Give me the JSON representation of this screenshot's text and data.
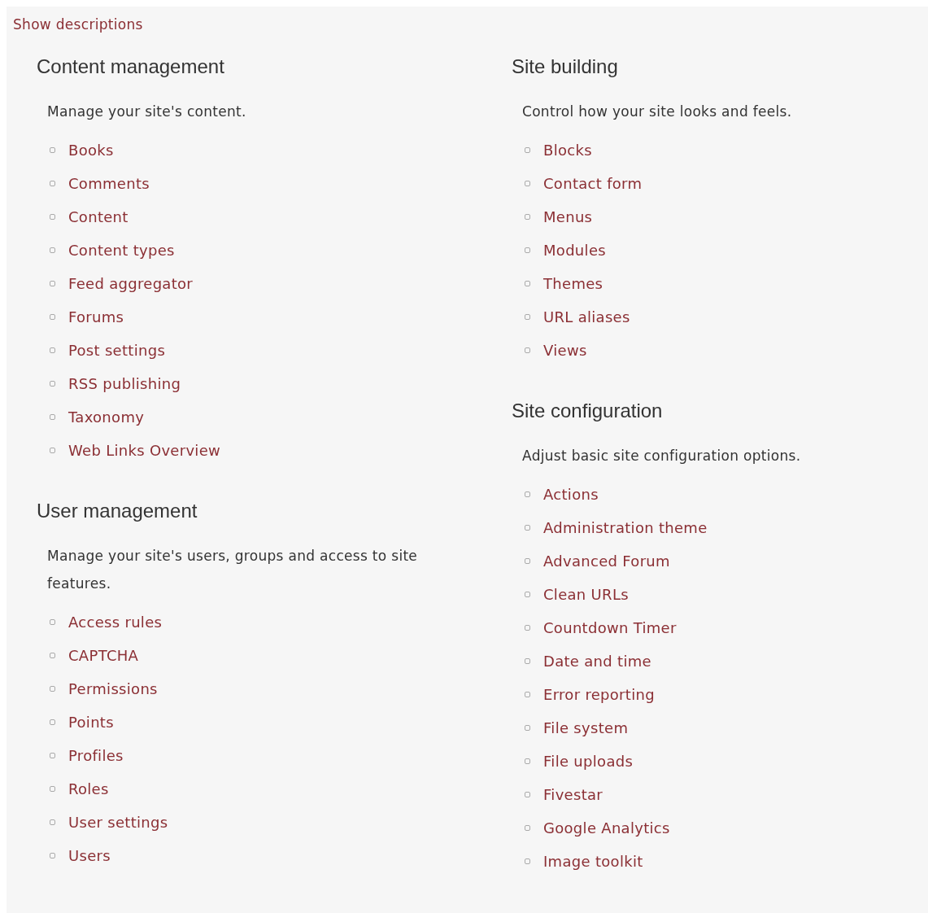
{
  "toggle_link": "Show descriptions",
  "columns": [
    [
      {
        "title": "Content management",
        "description": "Manage your site's content.",
        "links": [
          "Books",
          "Comments",
          "Content",
          "Content types",
          "Feed aggregator",
          "Forums",
          "Post settings",
          "RSS publishing",
          "Taxonomy",
          "Web Links Overview"
        ]
      },
      {
        "title": "User management",
        "description": "Manage your site's users, groups and access to site features.",
        "links": [
          "Access rules",
          "CAPTCHA",
          "Permissions",
          "Points",
          "Profiles",
          "Roles",
          "User settings",
          "Users"
        ]
      }
    ],
    [
      {
        "title": "Site building",
        "description": "Control how your site looks and feels.",
        "links": [
          "Blocks",
          "Contact form",
          "Menus",
          "Modules",
          "Themes",
          "URL aliases",
          "Views"
        ]
      },
      {
        "title": "Site configuration",
        "description": "Adjust basic site configuration options.",
        "links": [
          "Actions",
          "Administration theme",
          "Advanced Forum",
          "Clean URLs",
          "Countdown Timer",
          "Date and time",
          "Error reporting",
          "File system",
          "File uploads",
          "Fivestar",
          "Google Analytics",
          "Image toolkit"
        ]
      }
    ]
  ]
}
